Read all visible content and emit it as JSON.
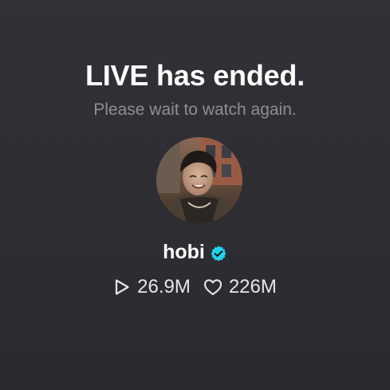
{
  "live": {
    "title": "LIVE has ended.",
    "subtitle": "Please wait to watch again."
  },
  "profile": {
    "name": "hobi",
    "verified": true,
    "avatar_icon": "profile-photo",
    "verified_icon": "verified-badge-icon",
    "verified_color": "#20d5ec"
  },
  "stats": {
    "views": "26.9M",
    "views_icon": "play-icon",
    "likes": "226M",
    "likes_icon": "heart-icon"
  },
  "colors": {
    "background": "#2e2e33",
    "title": "#ffffff",
    "subtitle": "#8e8e93",
    "stats": "#e6e6e8"
  }
}
